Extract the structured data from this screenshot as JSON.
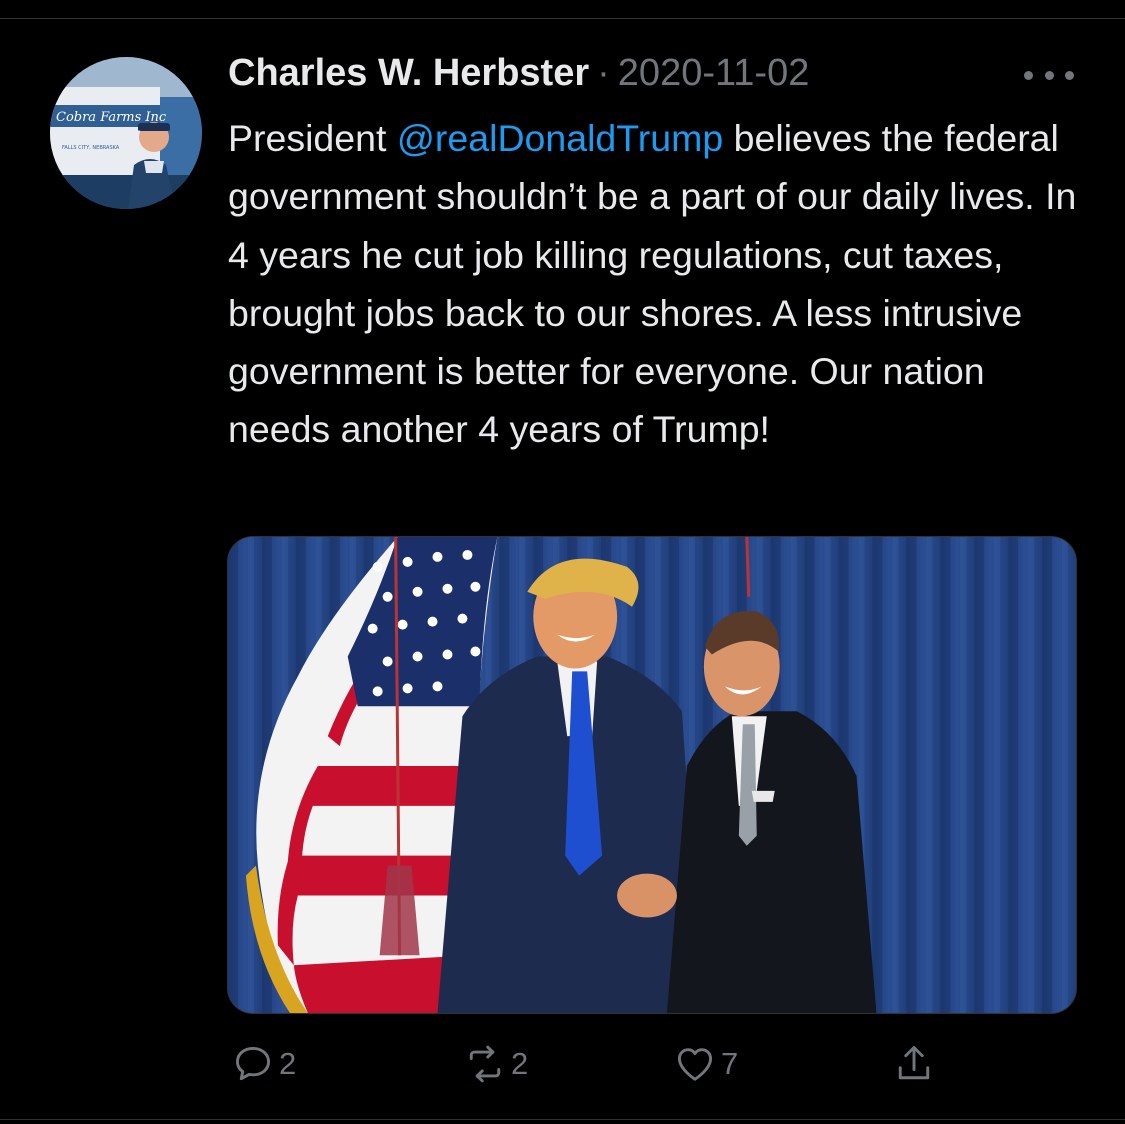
{
  "tweet": {
    "author_name": "Charles W. Herbster",
    "separator": "·",
    "date": "2020-11-02",
    "text_before": "President ",
    "mention": "@realDonaldTrump",
    "text_after": " believes the federal government shouldn’t be a part of our daily lives. In 4 years he cut job killing regulations, cut taxes, brought jobs back to our shores. A less intrusive government is better for everyone. Our nation needs another 4 years of Trump!",
    "avatar_truck_text": "Cobra Farms Inc",
    "avatar_small_text": "FALLS CITY, NEBRASKA"
  },
  "actions": {
    "replies": "2",
    "retweets": "2",
    "likes": "7"
  },
  "icons": {
    "more": "more-horizontal-icon",
    "reply": "reply-icon",
    "retweet": "retweet-icon",
    "like": "heart-icon",
    "share": "share-icon"
  },
  "colors": {
    "background": "#000000",
    "text": "#e7e9ea",
    "muted": "#71767b",
    "accent": "#1d9bf0",
    "divider": "#2f3336"
  }
}
